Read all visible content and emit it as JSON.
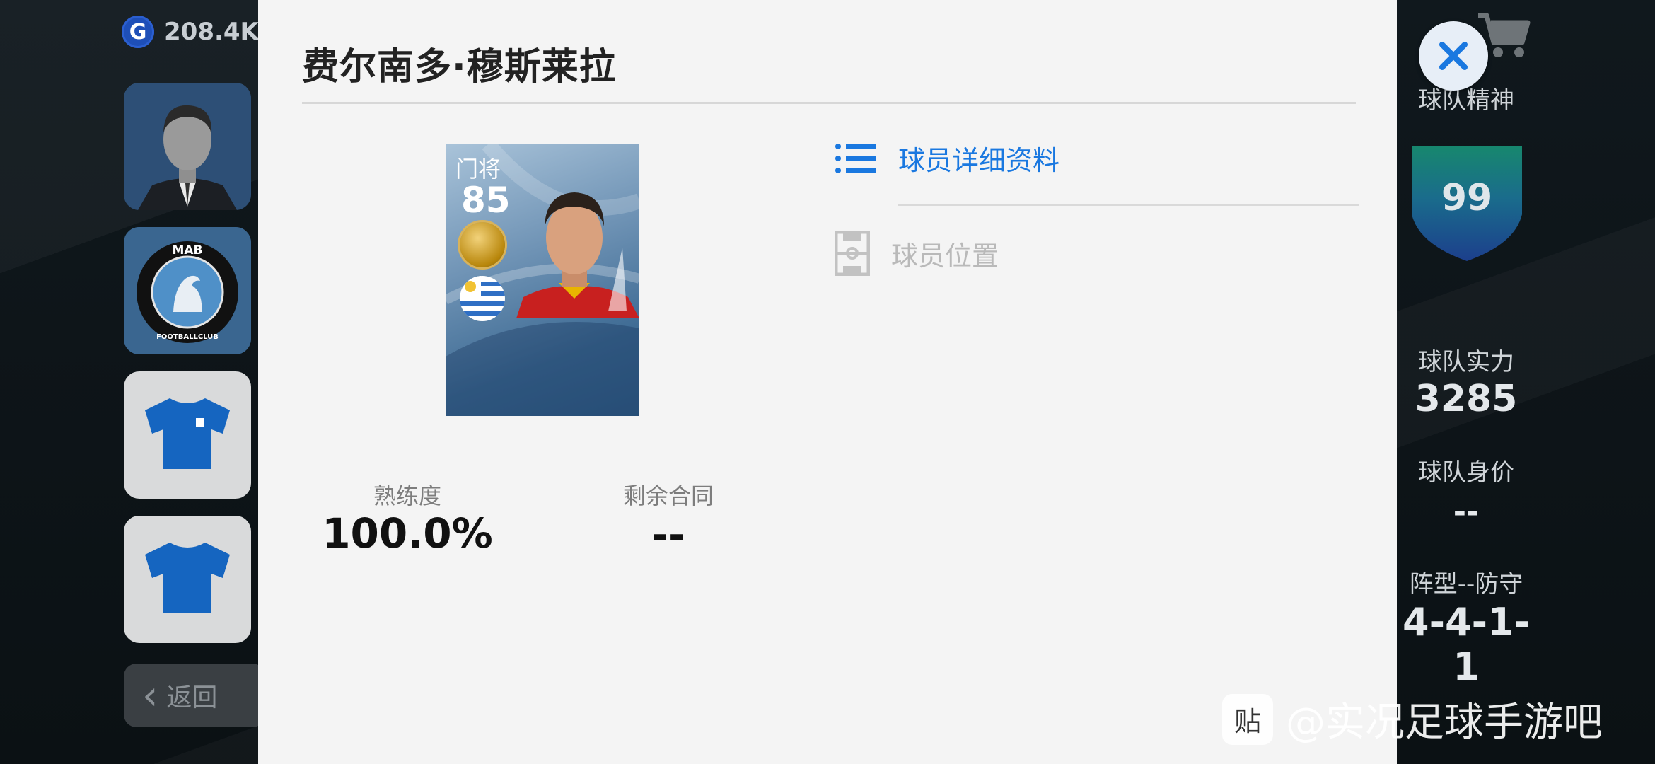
{
  "currency": {
    "icon": "G",
    "amount": "208.4K"
  },
  "left_menu": {
    "back_label": "返回"
  },
  "club_badge": {
    "ring_text_top": "MAB",
    "ring_text_bottom": "FOOTBALLCLUB"
  },
  "modal": {
    "title": "费尔南多·穆斯莱拉",
    "card": {
      "position": "门将",
      "rating": "85",
      "badge_icon": "gold-ball-icon",
      "flag": "uruguay-flag-icon"
    },
    "stats": [
      {
        "label": "熟练度",
        "value": "100.0%"
      },
      {
        "label": "剩余合同",
        "value": "--"
      }
    ],
    "menu": [
      {
        "label": "球员详细资料",
        "icon": "list-icon",
        "active": true
      },
      {
        "label": "球员位置",
        "icon": "pitch-icon",
        "active": false
      }
    ]
  },
  "right_panel": {
    "team_spirit_label": "球队精神",
    "team_spirit_value": "99",
    "team_strength_label": "球队实力",
    "team_strength_value": "3285",
    "team_value_label": "球队身价",
    "team_value_value": "--",
    "formation_label": "阵型--防守",
    "formation_value": "4-4-1-1"
  },
  "watermark": {
    "box": "贴",
    "text": "@实况足球手游吧"
  },
  "colors": {
    "accent": "#1a78e0",
    "shield": "#1e5aa0",
    "modal_bg": "#f4f4f4"
  }
}
